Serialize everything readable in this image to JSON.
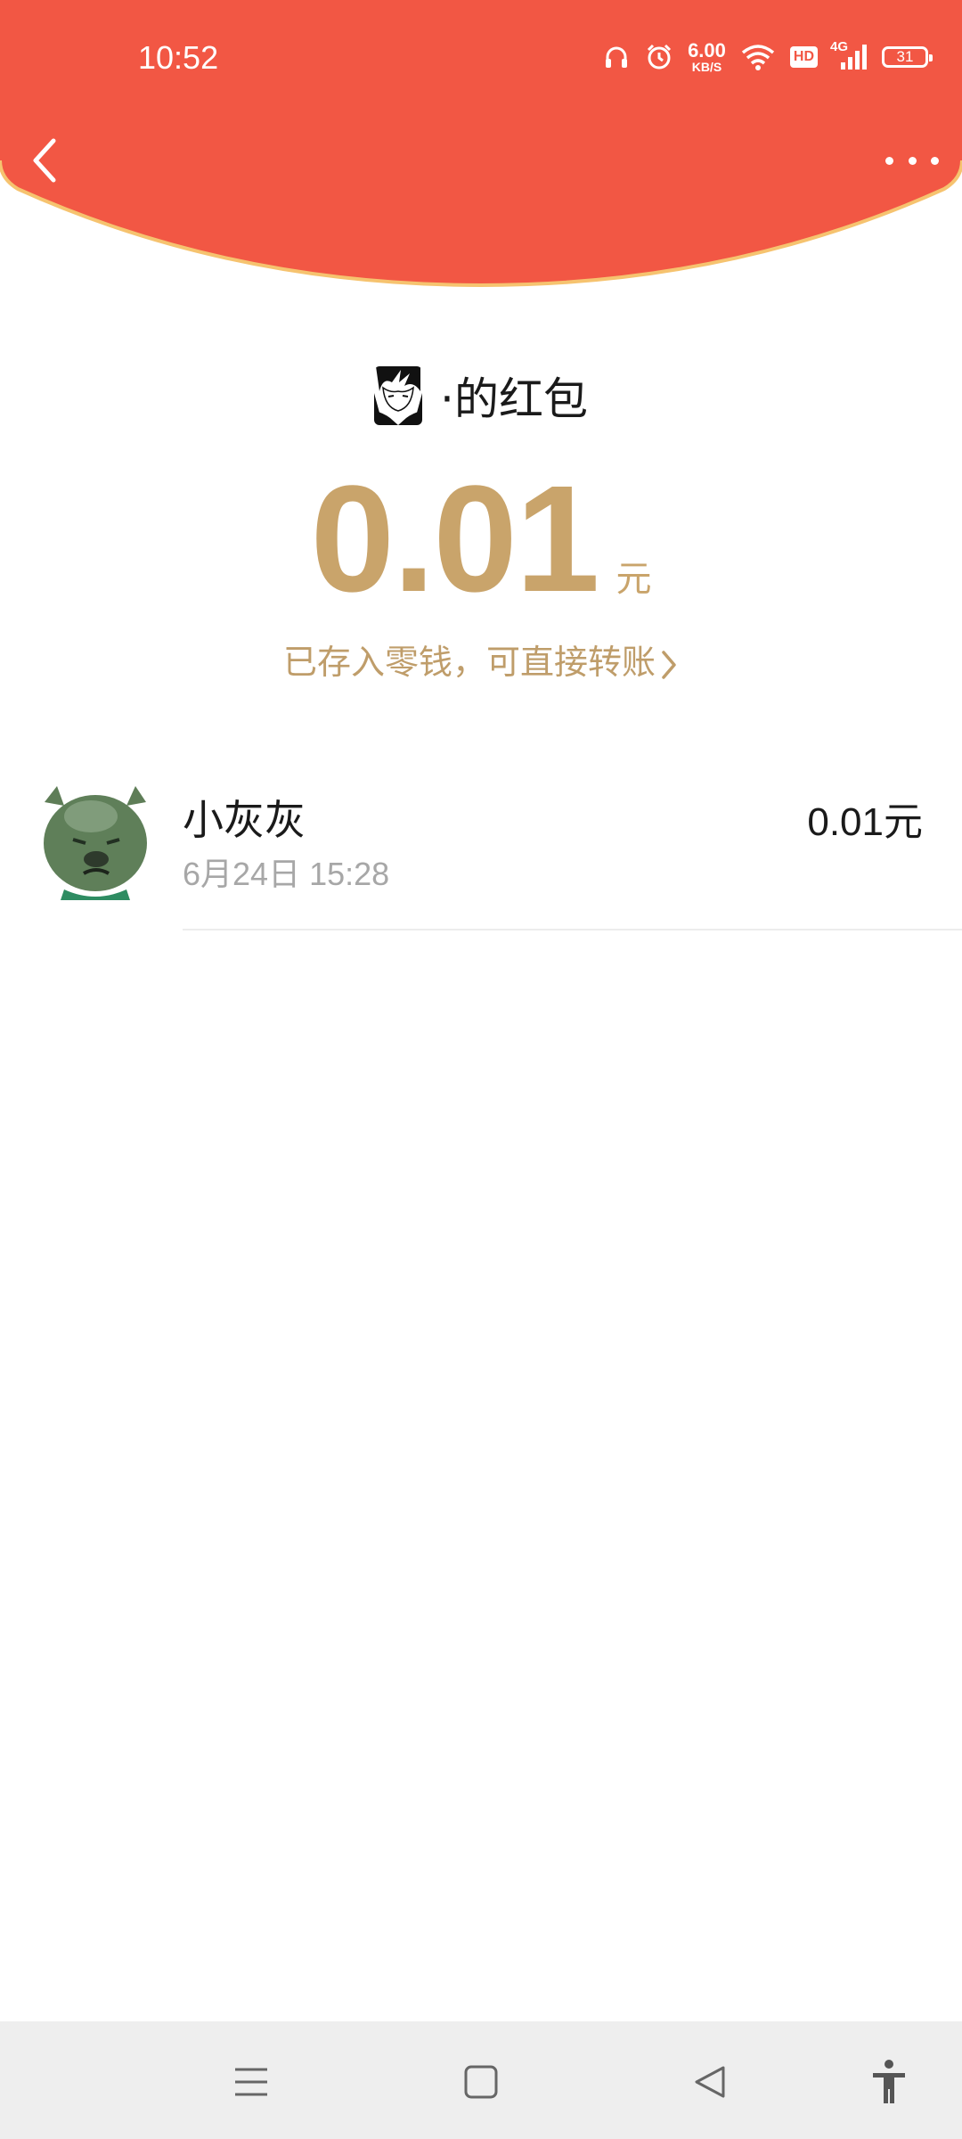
{
  "status_bar": {
    "time": "10:52",
    "net_speed": "6.00",
    "net_speed_unit": "KB/S",
    "hd_label": "HD",
    "network_type": "4G",
    "battery": "31",
    "icons": [
      "headphones-icon",
      "alarm-icon",
      "wifi-icon",
      "hd-icon",
      "signal-icon",
      "battery-icon"
    ]
  },
  "header": {
    "back_icon": "chevron-left-icon",
    "more_icon": "more-dots-icon",
    "color": "#f25744"
  },
  "sender": {
    "title": "·的红包",
    "avatar_icon": "anime-avatar"
  },
  "amount": {
    "value": "0.01",
    "unit": "元",
    "note": "已存入零钱，可直接转账",
    "color": "#c9a46b"
  },
  "receivers": [
    {
      "name": "小灰灰",
      "time": "6月24日  15:28",
      "amount": "0.01元",
      "avatar_icon": "green-pig-avatar"
    }
  ],
  "nav_bar": {
    "icons": [
      "menu-icon",
      "home-icon",
      "back-triangle-icon",
      "accessibility-icon"
    ]
  }
}
